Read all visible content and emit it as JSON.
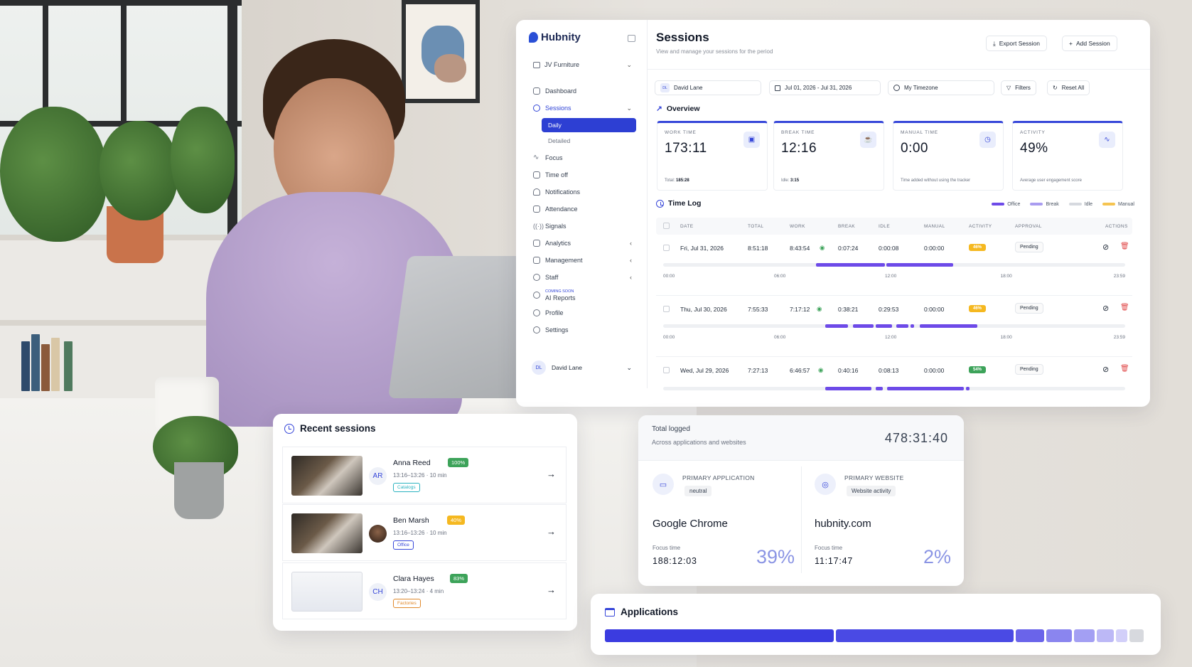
{
  "app": {
    "brand": "Hubnity",
    "org": "JV Furniture",
    "nav": [
      {
        "label": "Dashboard",
        "icon": "home-icon"
      },
      {
        "label": "Sessions",
        "icon": "history-icon",
        "active": true
      },
      {
        "label": "Focus",
        "icon": "pulse-icon"
      },
      {
        "label": "Time off",
        "icon": "calendar-icon"
      },
      {
        "label": "Notifications",
        "icon": "bell-icon"
      },
      {
        "label": "Attendance",
        "icon": "calendar-check-icon"
      },
      {
        "label": "Signals",
        "icon": "signal-icon"
      },
      {
        "label": "Analytics",
        "icon": "chart-icon"
      },
      {
        "label": "Management",
        "icon": "briefcase-icon"
      },
      {
        "label": "Staff",
        "icon": "users-icon"
      },
      {
        "label": "AI Reports",
        "badge": "COMING SOON",
        "icon": "ai-icon"
      },
      {
        "label": "Profile",
        "icon": "user-icon"
      },
      {
        "label": "Settings",
        "icon": "gear-icon"
      }
    ],
    "sub_nav": [
      "Daily",
      "Detailed"
    ],
    "user": {
      "initials": "DL",
      "name": "David Lane"
    },
    "page_title": "Sessions",
    "page_subtitle": "View and manage your sessions for the period",
    "buttons": {
      "export": "Export Session",
      "add": "Add Session"
    },
    "filters": {
      "user_initials": "DL",
      "user": "David Lane",
      "date_range": "Jul 01, 2026 - Jul 31, 2026",
      "timezone": "My Timezone",
      "filters": "Filters",
      "reset": "Reset All"
    },
    "overview_title": "Overview",
    "stats": [
      {
        "label": "WORK TIME",
        "value": "173:11",
        "note_label": "Total:",
        "note_value": "185:28",
        "icon": "briefcase-icon"
      },
      {
        "label": "BREAK TIME",
        "value": "12:16",
        "note_label": "Idle:",
        "note_value": "3:15",
        "icon": "coffee-icon"
      },
      {
        "label": "MANUAL TIME",
        "value": "0:00",
        "note_label": "Time added without using the tracker",
        "note_value": "",
        "icon": "clock-icon"
      },
      {
        "label": "ACTIVITY",
        "value": "49%",
        "note_label": "Average user engagement score",
        "note_value": "",
        "icon": "activity-icon"
      }
    ],
    "timelog_title": "Time Log",
    "legend": [
      {
        "label": "Office",
        "color": "#6d4ae8"
      },
      {
        "label": "Break",
        "color": "#a99cf0"
      },
      {
        "label": "Idle",
        "color": "#d6d9df"
      },
      {
        "label": "Manual",
        "color": "#f5c451"
      }
    ],
    "columns": [
      "DATE",
      "TOTAL",
      "WORK",
      "BREAK",
      "IDLE",
      "MANUAL",
      "ACTIVITY",
      "APPROVAL",
      "ACTIONS"
    ],
    "rows": [
      {
        "date": "Fri, Jul 31, 2026",
        "total": "8:51:18",
        "work": "8:43:54",
        "break": "0:07:24",
        "idle": "0:00:08",
        "manual": "0:00:00",
        "activity": "46%",
        "activity_color": "#f5b820",
        "approval": "Pending"
      },
      {
        "date": "Thu, Jul 30, 2026",
        "total": "7:55:33",
        "work": "7:17:12",
        "break": "0:38:21",
        "idle": "0:29:53",
        "manual": "0:00:00",
        "activity": "46%",
        "activity_color": "#f5b820",
        "approval": "Pending"
      },
      {
        "date": "Wed, Jul 29, 2026",
        "total": "7:27:13",
        "work": "6:46:57",
        "break": "0:40:16",
        "idle": "0:08:13",
        "manual": "0:00:00",
        "activity": "54%",
        "activity_color": "#3da35a",
        "approval": "Pending"
      }
    ],
    "timeline_ticks": [
      "00:00",
      "06:00",
      "12:00",
      "18:00",
      "23:59"
    ]
  },
  "recent": {
    "title": "Recent sessions",
    "items": [
      {
        "name": "Anna Reed",
        "initials": "AR",
        "pct": "100%",
        "pct_color": "#3da35a",
        "time": "13:16–13:26 · 10 min",
        "tag": "Catalogs",
        "tag_color": "#2bb3c0"
      },
      {
        "name": "Ben Marsh",
        "initials": "",
        "pct": "40%",
        "pct_color": "#f5b820",
        "time": "13:16–13:26 · 10 min",
        "tag": "Office",
        "tag_color": "#3646d9"
      },
      {
        "name": "Clara Hayes",
        "initials": "CH",
        "pct": "83%",
        "pct_color": "#3da35a",
        "time": "13:20–13:24 · 4 min",
        "tag": "Factories",
        "tag_color": "#e0892b"
      }
    ]
  },
  "total": {
    "title": "Total logged",
    "subtitle": "Across applications and websites",
    "value": "478:31:40",
    "app": {
      "key": "PRIMARY APPLICATION",
      "badge": "neutral",
      "name": "Google Chrome",
      "focus_label": "Focus time",
      "focus_time": "188:12:03",
      "pct": "39%"
    },
    "web": {
      "key": "PRIMARY WEBSITE",
      "badge": "Website activity",
      "name": "hubnity.com",
      "focus_label": "Focus time",
      "focus_time": "11:17:47",
      "pct": "2%"
    }
  },
  "applications": {
    "title": "Applications",
    "segments": [
      {
        "share": 0.4,
        "color": "#3b3ce0"
      },
      {
        "share": 0.31,
        "color": "#4a4ae4"
      },
      {
        "share": 0.05,
        "color": "#6a64ea"
      },
      {
        "share": 0.045,
        "color": "#8a85ef"
      },
      {
        "share": 0.035,
        "color": "#a39ff3"
      },
      {
        "share": 0.03,
        "color": "#bcb8f6"
      },
      {
        "share": 0.02,
        "color": "#d2cff9"
      },
      {
        "share": 0.025,
        "color": "#d7d9de"
      }
    ]
  }
}
